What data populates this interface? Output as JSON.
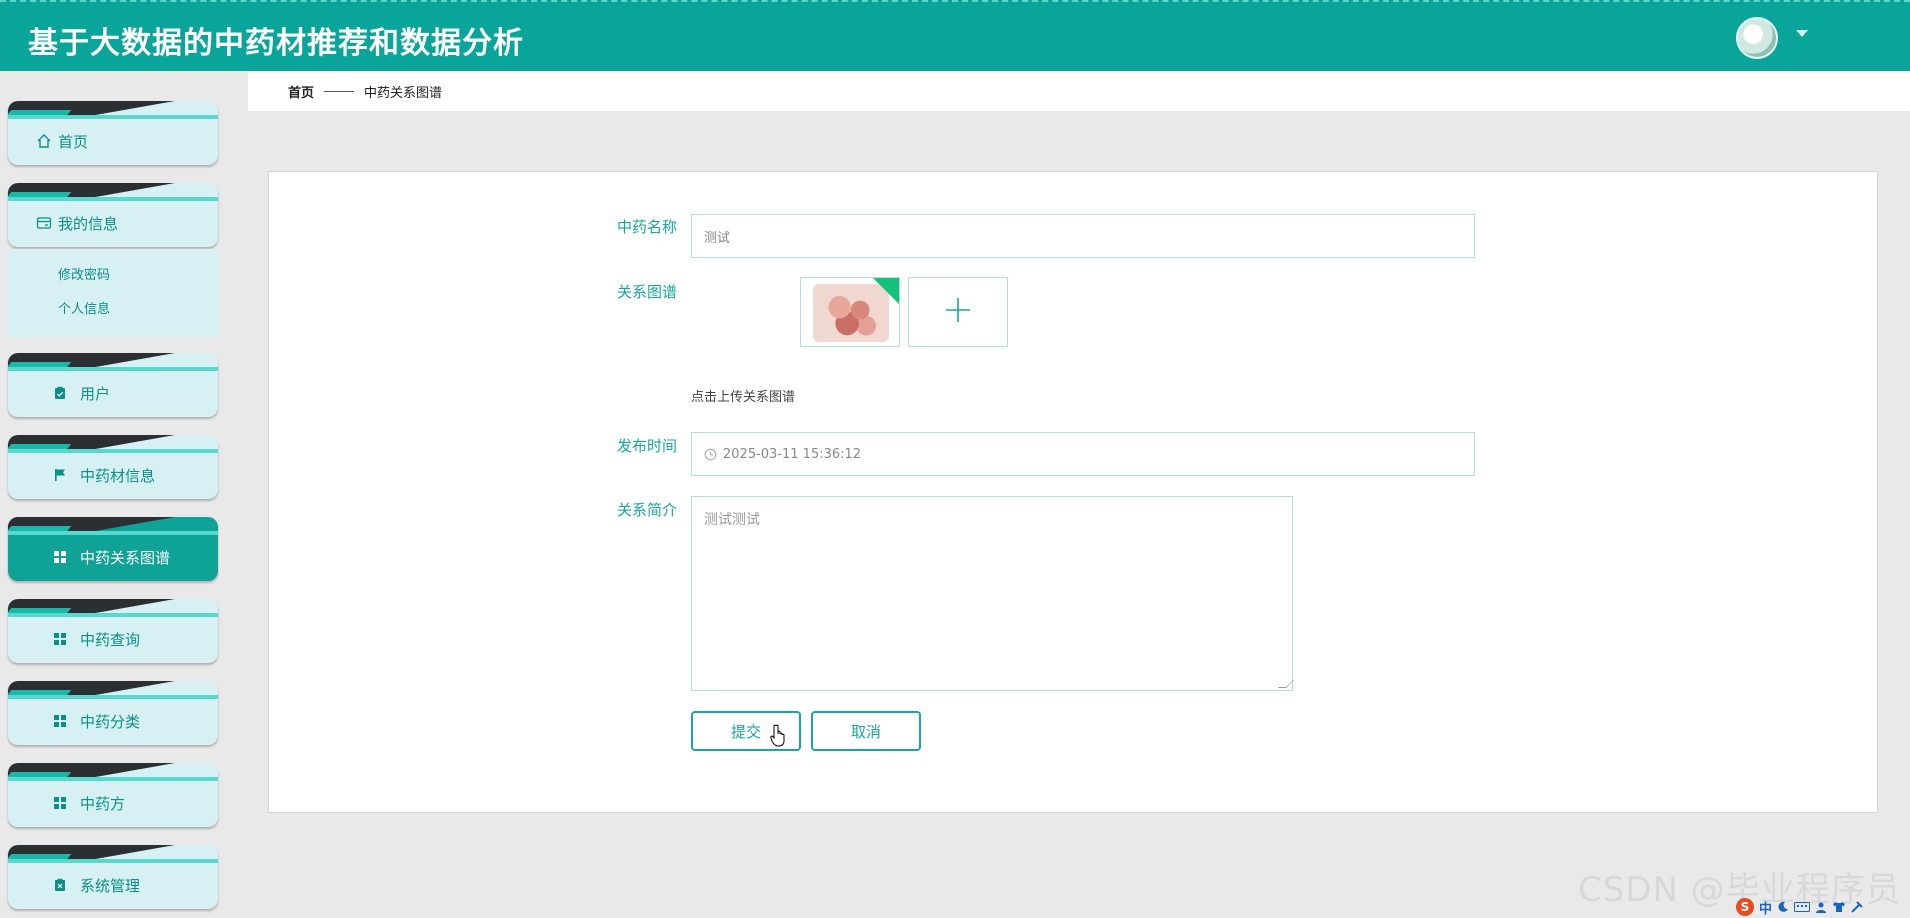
{
  "header": {
    "title": "基于大数据的中药材推荐和数据分析",
    "avatar_icon": "user-avatar",
    "dropdown_icon": "caret-down-icon"
  },
  "sidebar": {
    "items": [
      {
        "label": "首页",
        "icon": "home-icon"
      },
      {
        "label": "我的信息",
        "icon": "card-icon"
      },
      {
        "label": "用户",
        "icon": "clipboard-icon"
      },
      {
        "label": "中药材信息",
        "icon": "flag-icon"
      },
      {
        "label": "中药关系图谱",
        "icon": "grid-icon",
        "active": true
      },
      {
        "label": "中药查询",
        "icon": "grid-icon"
      },
      {
        "label": "中药分类",
        "icon": "grid-icon"
      },
      {
        "label": "中药方",
        "icon": "grid-icon"
      },
      {
        "label": "系统管理",
        "icon": "clipboard-x-icon"
      }
    ],
    "submenu": [
      "修改密码",
      "个人信息"
    ]
  },
  "breadcrumb": {
    "home": "首页",
    "current": "中药关系图谱"
  },
  "form": {
    "name_label": "中药名称",
    "name_value": "测试",
    "graph_label": "关系图谱",
    "upload_hint": "点击上传关系图谱",
    "time_label": "发布时间",
    "time_value": "2025-03-11 15:36:12",
    "intro_label": "关系简介",
    "intro_value": "测试测试",
    "submit_label": "提交",
    "cancel_label": "取消"
  },
  "watermark": "CSDN @毕业程序员",
  "colors": {
    "primary": "#0aa59a",
    "accent_text": "#1aa69b",
    "nav_bg": "#d6f0f3",
    "active_nav": "#0fa296"
  }
}
